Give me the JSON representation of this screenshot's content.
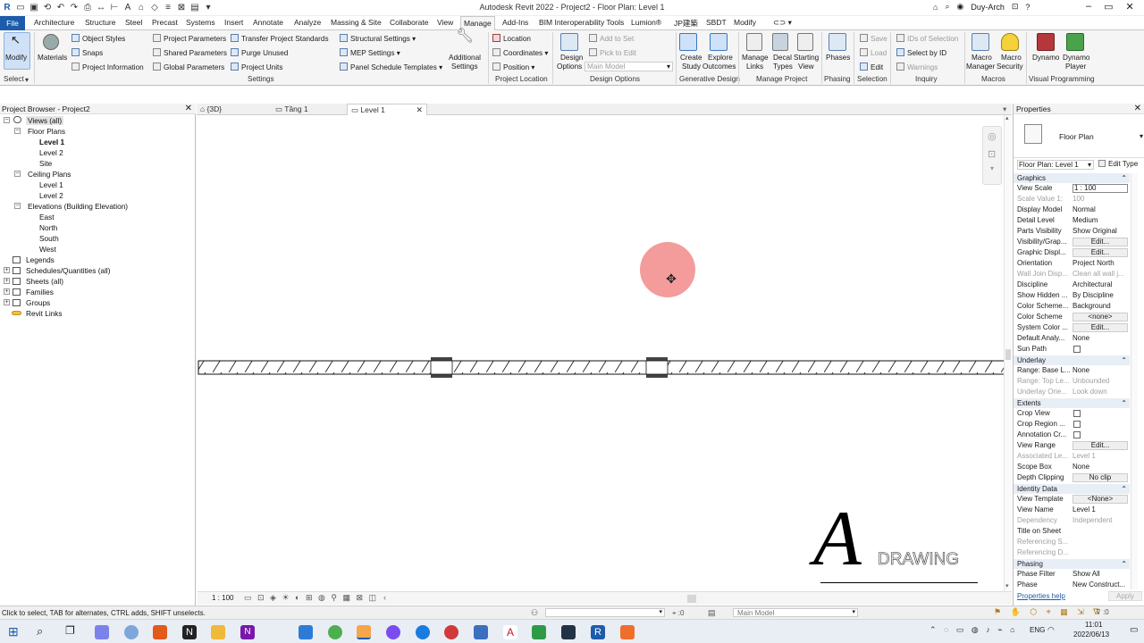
{
  "title_bar": {
    "app_title": "Autodesk Revit 2022 - Project2 - Floor Plan: Level 1",
    "user": "Duy-Arch"
  },
  "ribbon_tabs": [
    {
      "label": "File"
    },
    {
      "label": "Architecture"
    },
    {
      "label": "Structure"
    },
    {
      "label": "Steel"
    },
    {
      "label": "Precast"
    },
    {
      "label": "Systems"
    },
    {
      "label": "Insert"
    },
    {
      "label": "Annotate"
    },
    {
      "label": "Analyze"
    },
    {
      "label": "Massing & Site"
    },
    {
      "label": "Collaborate"
    },
    {
      "label": "View"
    },
    {
      "label": "Manage"
    },
    {
      "label": "Add-Ins"
    },
    {
      "label": "BIM Interoperability Tools"
    },
    {
      "label": "Lumion®"
    },
    {
      "label": "JP建築"
    },
    {
      "label": "SBDT"
    },
    {
      "label": "Modify"
    }
  ],
  "ribbon": {
    "modify": "Modify",
    "select": "Select",
    "materials": "Materials",
    "object_styles": "Object Styles",
    "snaps": "Snaps",
    "project_information": "Project Information",
    "project_parameters": "Project Parameters",
    "shared_parameters": "Shared Parameters",
    "global_parameters": "Global Parameters",
    "transfer_project_standards": "Transfer Project Standards",
    "purge_unused": "Purge Unused",
    "project_units": "Project Units",
    "structural_settings": "Structural Settings",
    "mep_settings": "MEP Settings",
    "panel_schedule_templates": "Panel Schedule Templates",
    "additional_settings_1": "Additional",
    "additional_settings_2": "Settings",
    "settings_group": "Settings",
    "location": "Location",
    "coordinates": "Coordinates",
    "position": "Position",
    "project_location_group": "Project Location",
    "design_options_1": "Design",
    "design_options_2": "Options",
    "add_to_set": "Add to Set",
    "pick_to_edit": "Pick to Edit",
    "main_model": "Main Model",
    "design_options_group": "Design Options",
    "create_study_1": "Create",
    "create_study_2": "Study",
    "explore_outcomes_1": "Explore",
    "explore_outcomes_2": "Outcomes",
    "generative_design_group": "Generative Design",
    "manage_links_1": "Manage",
    "manage_links_2": "Links",
    "decal_types_1": "Decal",
    "decal_types_2": "Types",
    "starting_view_1": "Starting",
    "starting_view_2": "View",
    "manage_project_group": "Manage Project",
    "phases": "Phases",
    "phasing_group": "Phasing",
    "save": "Save",
    "load": "Load",
    "edit": "Edit",
    "selection_group": "Selection",
    "ids_of_selection": "IDs of Selection",
    "select_by_id": "Select by ID",
    "warnings": "Warnings",
    "inquiry_group": "Inquiry",
    "macro_manager_1": "Macro",
    "macro_manager_2": "Manager",
    "macro_security_1": "Macro",
    "macro_security_2": "Security",
    "macros_group": "Macros",
    "dynamo": "Dynamo",
    "dynamo_player_1": "Dynamo",
    "dynamo_player_2": "Player",
    "visual_programming_group": "Visual Programming"
  },
  "project_browser": {
    "title": "Project Browser - Project2",
    "nodes": [
      {
        "label": "Views (all)"
      },
      {
        "label": "Floor Plans"
      },
      {
        "label": "Level 1"
      },
      {
        "label": "Level 2"
      },
      {
        "label": "Site"
      },
      {
        "label": "Ceiling Plans"
      },
      {
        "label": "Level 1"
      },
      {
        "label": "Level 2"
      },
      {
        "label": "Elevations (Building Elevation)"
      },
      {
        "label": "East"
      },
      {
        "label": "North"
      },
      {
        "label": "South"
      },
      {
        "label": "West"
      },
      {
        "label": "Legends"
      },
      {
        "label": "Schedules/Quantities (all)"
      },
      {
        "label": "Sheets (all)"
      },
      {
        "label": "Families"
      },
      {
        "label": "Groups"
      },
      {
        "label": "Revit Links"
      }
    ]
  },
  "view_tabs": [
    {
      "label": "{3D}"
    },
    {
      "label": "Tầng 1"
    },
    {
      "label": "Level 1"
    }
  ],
  "view_bar": {
    "scale": "1 : 100"
  },
  "watermark": {
    "letter": "A",
    "word": "DRAWING"
  },
  "properties": {
    "title": "Properties",
    "type_name": "Floor Plan",
    "instance_selector": "Floor Plan: Level 1",
    "edit_type": "Edit Type",
    "help_link": "Properties help",
    "apply": "Apply",
    "categories": {
      "graphics": "Graphics",
      "underlay": "Underlay",
      "extents": "Extents",
      "identity_data": "Identity Data",
      "phasing": "Phasing"
    },
    "rows": [
      {
        "name": "View Scale",
        "value": "1 : 100"
      },
      {
        "name": "Scale Value    1:",
        "value": "100"
      },
      {
        "name": "Display Model",
        "value": "Normal"
      },
      {
        "name": "Detail Level",
        "value": "Medium"
      },
      {
        "name": "Parts Visibility",
        "value": "Show Original"
      },
      {
        "name": "Visibility/Grap...",
        "value": "Edit..."
      },
      {
        "name": "Graphic Displ...",
        "value": "Edit..."
      },
      {
        "name": "Orientation",
        "value": "Project North"
      },
      {
        "name": "Wall Join Disp...",
        "value": "Clean all wall j..."
      },
      {
        "name": "Discipline",
        "value": "Architectural"
      },
      {
        "name": "Show Hidden ...",
        "value": "By Discipline"
      },
      {
        "name": "Color Scheme...",
        "value": "Background"
      },
      {
        "name": "Color Scheme",
        "value": "<none>"
      },
      {
        "name": "System Color ...",
        "value": "Edit..."
      },
      {
        "name": "Default Analy...",
        "value": "None"
      },
      {
        "name": "Sun Path",
        "value": ""
      },
      {
        "name": "Range: Base L...",
        "value": "None"
      },
      {
        "name": "Range: Top Le...",
        "value": "Unbounded"
      },
      {
        "name": "Underlay Orie...",
        "value": "Look down"
      },
      {
        "name": "Crop View",
        "value": ""
      },
      {
        "name": "Crop Region ...",
        "value": ""
      },
      {
        "name": "Annotation Cr...",
        "value": ""
      },
      {
        "name": "View Range",
        "value": "Edit..."
      },
      {
        "name": "Associated Le...",
        "value": "Level 1"
      },
      {
        "name": "Scope Box",
        "value": "None"
      },
      {
        "name": "Depth Clipping",
        "value": "No clip"
      },
      {
        "name": "View Template",
        "value": "<None>"
      },
      {
        "name": "View Name",
        "value": "Level 1"
      },
      {
        "name": "Dependency",
        "value": "Independent"
      },
      {
        "name": "Title on Sheet",
        "value": ""
      },
      {
        "name": "Referencing S...",
        "value": ""
      },
      {
        "name": "Referencing D...",
        "value": ""
      },
      {
        "name": "Phase Filter",
        "value": "Show All"
      },
      {
        "name": "Phase",
        "value": "New Construct..."
      }
    ]
  },
  "status_bar": {
    "message": "Click to select, TAB for alternates, CTRL adds, SHIFT unselects.",
    "selection_count": ":0",
    "model": "Main Model"
  },
  "taskbar": {
    "language": "ENG",
    "time": "11:01",
    "date": "2022/06/13"
  }
}
